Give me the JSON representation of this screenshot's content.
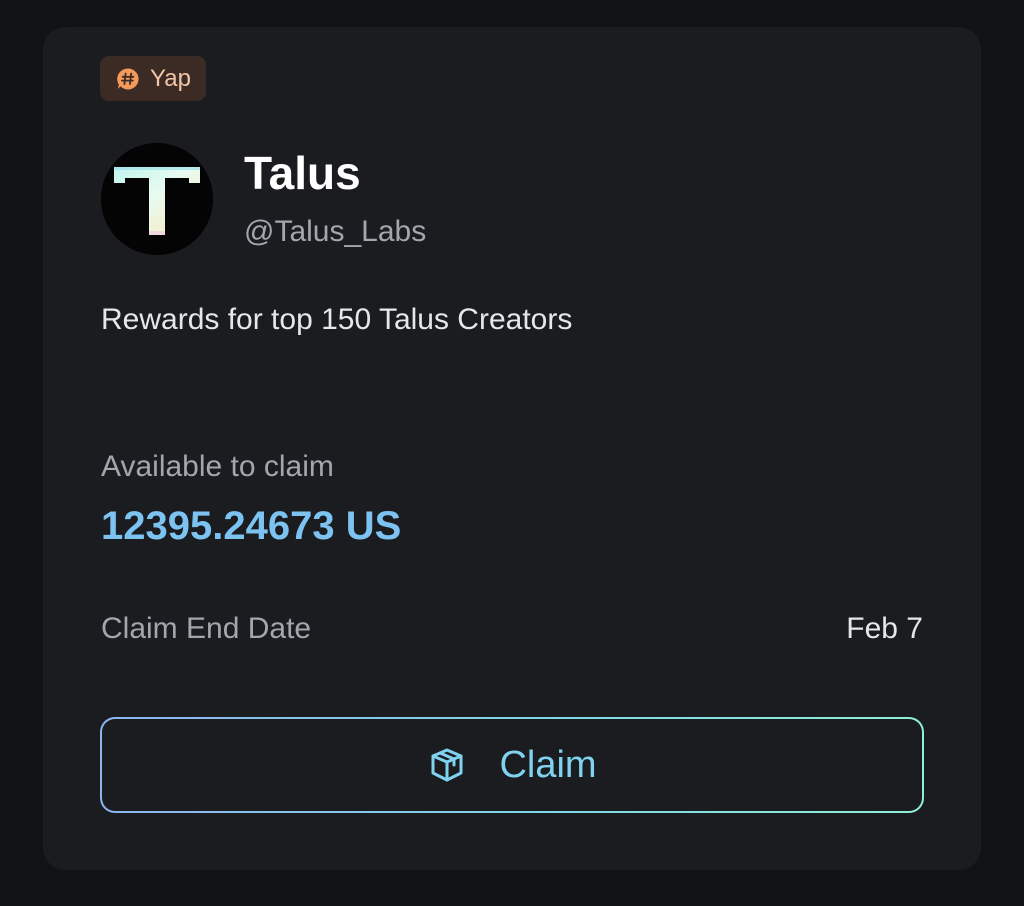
{
  "badge": {
    "label": "Yap",
    "icon": "hashtag-chat-icon",
    "color": "#f39a5b"
  },
  "project": {
    "name": "Talus",
    "handle": "@Talus_Labs",
    "avatar_icon": "talus-t-logo"
  },
  "description": "Rewards for top 150 Talus Creators",
  "claim_info": {
    "available_label": "Available to claim",
    "available_amount": "12395.24673 US",
    "end_date_label": "Claim End Date",
    "end_date_value": "Feb 7"
  },
  "claim_button": {
    "label": "Claim",
    "icon": "box-icon"
  },
  "colors": {
    "background": "#111215",
    "card": "#1b1c20",
    "accent_blue": "#7cc3f2",
    "accent_teal": "#7fd3ef"
  }
}
